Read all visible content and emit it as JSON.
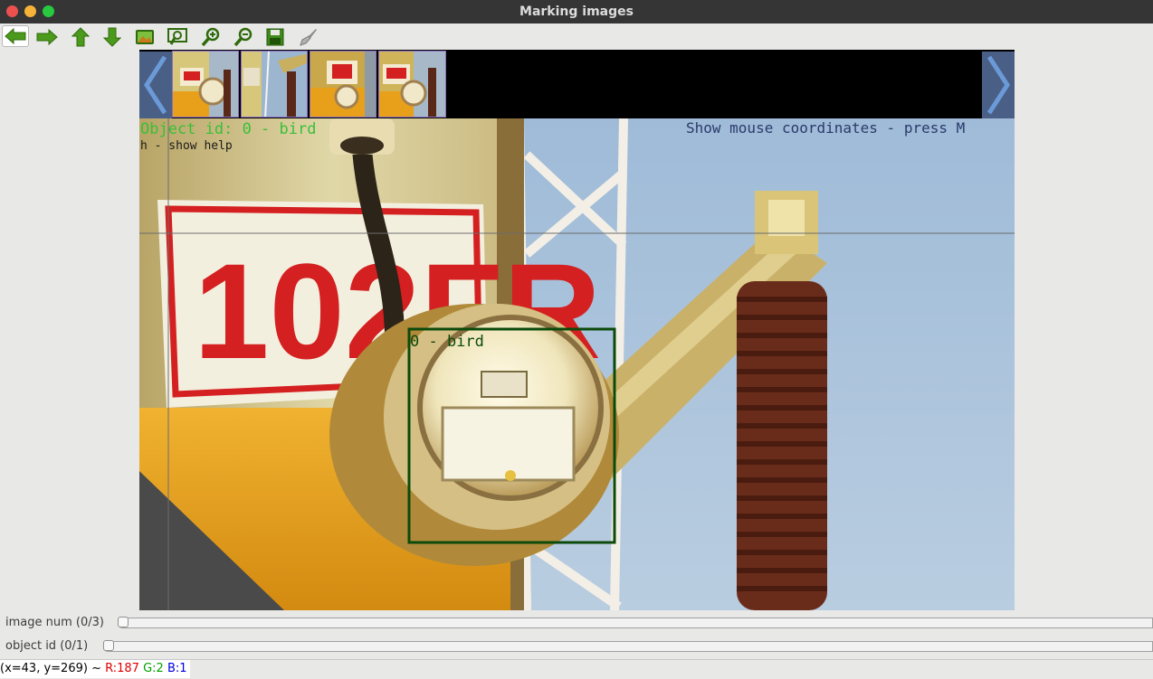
{
  "window": {
    "title": "Marking images"
  },
  "toolbar": {
    "buttons": [
      {
        "name": "back-icon"
      },
      {
        "name": "forward-icon"
      },
      {
        "name": "up-icon"
      },
      {
        "name": "down-icon"
      },
      {
        "name": "image-icon"
      },
      {
        "name": "zoom-fit-icon"
      },
      {
        "name": "zoom-in-icon"
      },
      {
        "name": "zoom-out-icon"
      },
      {
        "name": "save-icon"
      },
      {
        "name": "brush-icon"
      }
    ]
  },
  "canvas": {
    "overlay": {
      "object_id": "Object id: 0   - bird",
      "help_hint": "h - show help",
      "mouse_hint": "Show mouse coordinates - press M"
    },
    "pole_sign": "102FR",
    "bbox_label": "0 - bird"
  },
  "trackbars": [
    {
      "label": "image num  (0/3)",
      "value": 0,
      "max": 3
    },
    {
      "label": "object id  (0/1)",
      "value": 0,
      "max": 1
    }
  ],
  "status": {
    "coords": "(x=43, y=269) ~ ",
    "r": "R:187",
    "g": "G:2",
    "b": "B:1",
    "colors": {
      "r": "#e00000",
      "g": "#00a000",
      "b": "#0000e0"
    }
  }
}
